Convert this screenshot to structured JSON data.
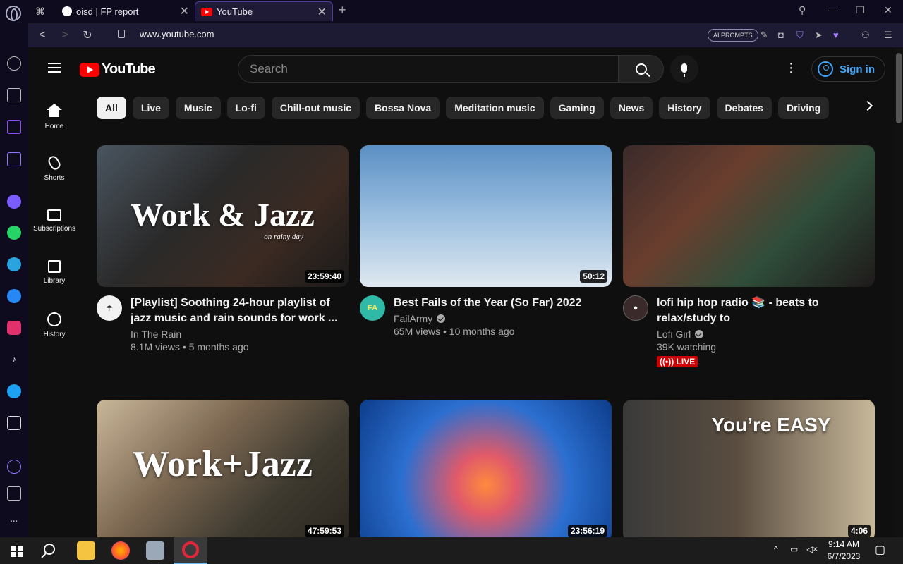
{
  "browser": {
    "tabs": [
      {
        "title": "oisd | FP report",
        "active": false
      },
      {
        "title": "YouTube",
        "active": true
      }
    ],
    "url": "www.youtube.com",
    "ai_prompts_label": "AI PROMPTS"
  },
  "youtube": {
    "logo_text": "YouTube",
    "search_placeholder": "Search",
    "sign_in_label": "Sign in",
    "chips": [
      "All",
      "Live",
      "Music",
      "Lo-fi",
      "Chill-out music",
      "Bossa Nova",
      "Meditation music",
      "Gaming",
      "News",
      "History",
      "Debates",
      "Driving"
    ],
    "sidebar": [
      {
        "label": "Home",
        "icon": "home-icon"
      },
      {
        "label": "Shorts",
        "icon": "shorts-icon"
      },
      {
        "label": "Subscriptions",
        "icon": "subscriptions-icon"
      },
      {
        "label": "Library",
        "icon": "library-icon"
      },
      {
        "label": "History",
        "icon": "history-icon"
      }
    ],
    "videos": [
      {
        "title": "[Playlist] Soothing 24-hour playlist of jazz music and rain sounds for work ...",
        "channel": "In The Rain",
        "verified": false,
        "views": "8.1M views • 5 months ago",
        "duration": "23:59:40",
        "thumb_text": "Work & Jazz",
        "thumb_subtext": "on rainy day",
        "live": ""
      },
      {
        "title": "Best Fails of the Year (So Far) 2022",
        "channel": "FailArmy",
        "verified": true,
        "views": "65M views • 10 months ago",
        "duration": "50:12",
        "thumb_text": "",
        "live": ""
      },
      {
        "title": "lofi hip hop radio 📚 - beats to relax/study to",
        "channel": "Lofi Girl",
        "verified": true,
        "views": "39K watching",
        "duration": "",
        "thumb_text": "",
        "live": "LIVE"
      },
      {
        "title": "",
        "channel": "",
        "duration": "47:59:53",
        "thumb_text": "Work+Jazz"
      },
      {
        "title": "",
        "channel": "",
        "duration": "23:56:19",
        "thumb_text": ""
      },
      {
        "title": "",
        "channel": "",
        "duration": "4:06",
        "thumb_text": "You’re EASY"
      }
    ]
  },
  "taskbar": {
    "time": "9:14 AM",
    "date": "6/7/2023"
  },
  "colors": {
    "youtube_red": "#ff0000",
    "link_blue": "#3ea6ff",
    "browser_bg": "#0e0b1e"
  }
}
